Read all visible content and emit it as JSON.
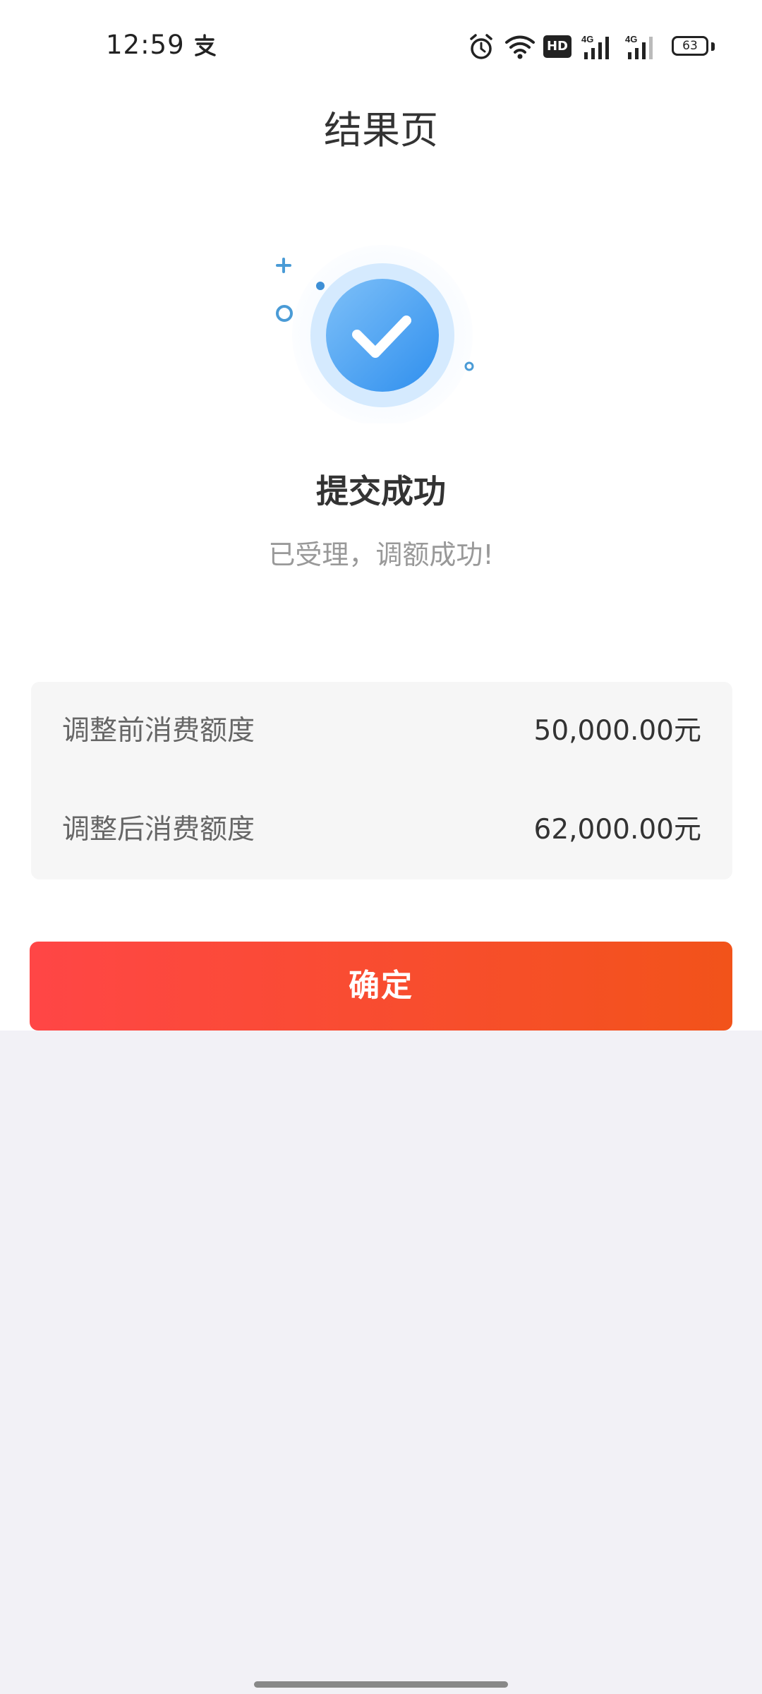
{
  "status_bar": {
    "time": "12:59",
    "hd_label": "HD",
    "battery_level": "63"
  },
  "header": {
    "title": "结果页"
  },
  "result": {
    "title": "提交成功",
    "subtitle": "已受理，调额成功!"
  },
  "info": {
    "before_label": "调整前消费额度",
    "before_value": "50,000.00元",
    "after_label": "调整后消费额度",
    "after_value": "62,000.00元"
  },
  "actions": {
    "confirm_label": "确定"
  },
  "colors": {
    "accent_start": "#ff4646",
    "accent_end": "#f2531a",
    "success_blue": "#3a9af0"
  },
  "icons": {
    "success": "check-circle-icon",
    "status": [
      "alipay-icon",
      "alarm-icon",
      "wifi-icon",
      "hd-icon",
      "signal-4g-icon",
      "signal-4g-icon",
      "battery-icon"
    ]
  }
}
